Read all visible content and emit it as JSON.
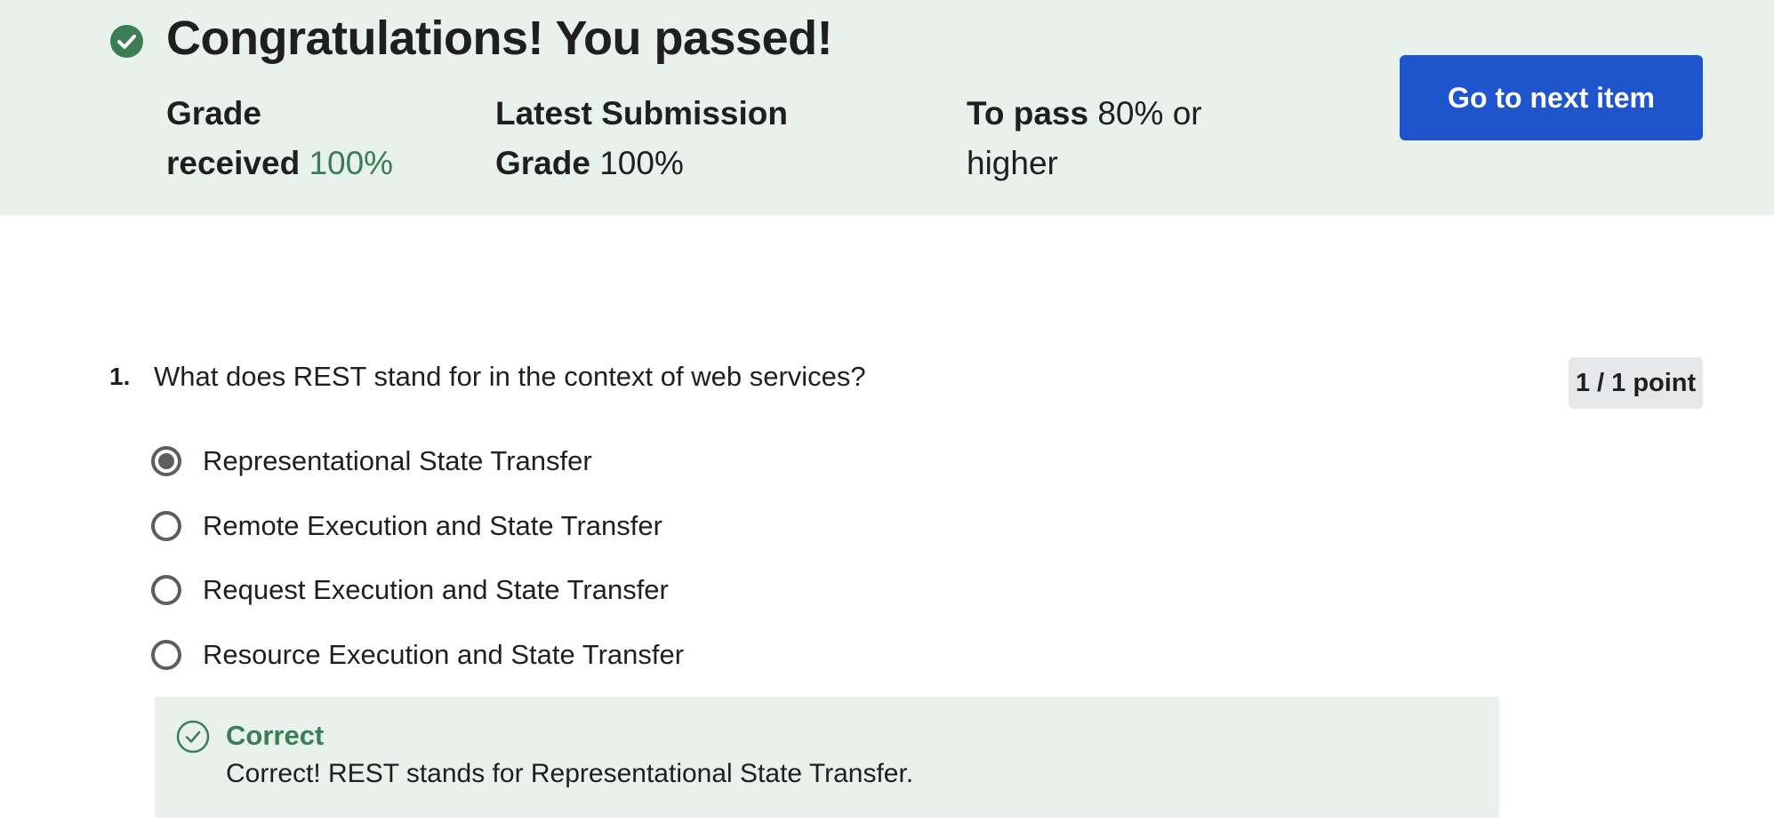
{
  "banner": {
    "title": "Congratulations! You passed!",
    "grade_label_line1": "Grade",
    "grade_label_line2": "received",
    "grade_value": "100%",
    "latest_label_line1": "Latest Submission",
    "latest_label_line2": "Grade",
    "latest_value": "100%",
    "pass_label": "To pass",
    "pass_value_line1": "80% or",
    "pass_value_line2": "higher",
    "next_button": "Go to next item",
    "icon": "check-circle-filled-icon"
  },
  "question": {
    "number": "1.",
    "text": "What does REST stand for in the context of web services?",
    "points": "1 / 1 point",
    "options": [
      {
        "label": "Representational State Transfer",
        "selected": true
      },
      {
        "label": "Remote Execution and State Transfer",
        "selected": false
      },
      {
        "label": "Request Execution and State Transfer",
        "selected": false
      },
      {
        "label": "Resource Execution and State Transfer",
        "selected": false
      }
    ],
    "feedback": {
      "title": "Correct",
      "text": "Correct! REST stands for Representational State Transfer.",
      "icon": "check-circle-outline-icon"
    }
  },
  "colors": {
    "banner_bg": "#e8f1ec",
    "success_green": "#3b7d54",
    "primary_button": "#1f55cc",
    "radio_gray": "#5e5e5e"
  }
}
